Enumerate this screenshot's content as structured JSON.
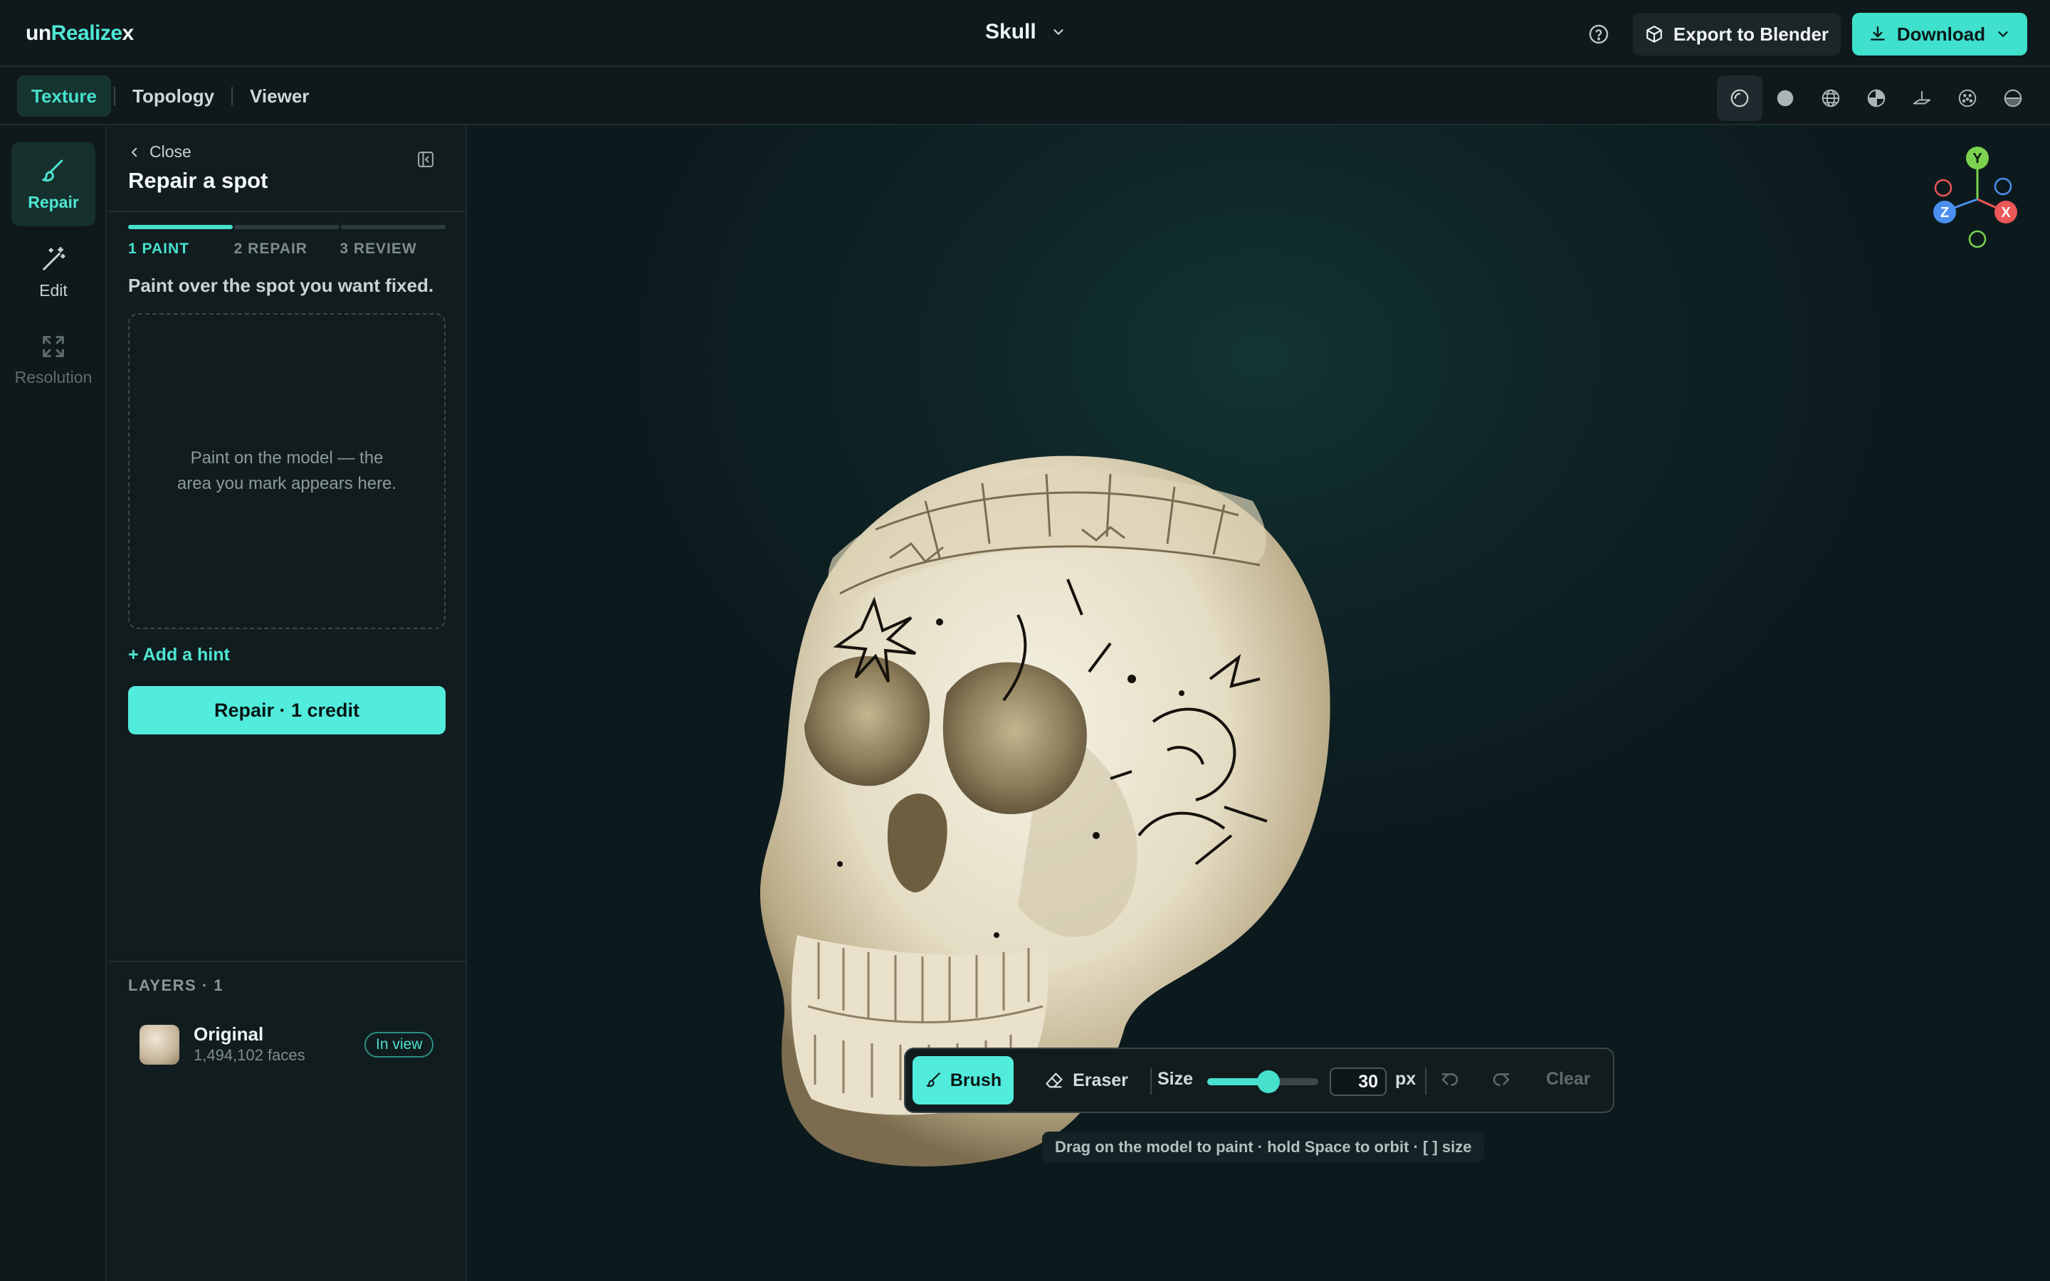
{
  "app": {
    "logo_prefix": "un",
    "logo_accent": "Realize",
    "logo_suffix": "x",
    "brand_color": "#46e0cd"
  },
  "header": {
    "title": "Skull",
    "export_label": "Export to Blender",
    "download_label": "Download"
  },
  "mode_tabs": [
    {
      "label": "Texture",
      "active": true
    },
    {
      "label": "Topology",
      "active": false
    },
    {
      "label": "Viewer",
      "active": false
    }
  ],
  "view_modes": [
    "shaded-icon",
    "solid-icon",
    "wireframe-icon",
    "uv-checker-icon",
    "plane-icon",
    "texture-dots-icon",
    "half-sphere-icon"
  ],
  "rail": [
    {
      "label": "Repair",
      "icon": "brush-icon",
      "state": "active"
    },
    {
      "label": "Edit",
      "icon": "magic-wand-icon",
      "state": "normal"
    },
    {
      "label": "Resolution",
      "icon": "expand-icon",
      "state": "disabled"
    }
  ],
  "panel": {
    "close_label": "Close",
    "title": "Repair a spot",
    "steps": [
      {
        "label": "1 PAINT",
        "active": true
      },
      {
        "label": "2 REPAIR",
        "active": false
      },
      {
        "label": "3 REVIEW",
        "active": false
      }
    ],
    "instruction": "Paint over the spot you want fixed.",
    "paint_placeholder": "Paint on the model — the area you mark appears here.",
    "add_hint_label": "+ Add a hint",
    "repair_button_label": "Repair · 1 credit"
  },
  "layers": {
    "title": "LAYERS · 1",
    "items": [
      {
        "name": "Original",
        "meta": "1,494,102 faces",
        "badge": "In view"
      }
    ]
  },
  "gizmo": {
    "y": "Y",
    "x": "X",
    "z": "Z"
  },
  "toolbar": {
    "brush_label": "Brush",
    "eraser_label": "Eraser",
    "size_label": "Size",
    "size_value": "30",
    "size_fraction": 0.55,
    "unit": "px",
    "clear_label": "Clear"
  },
  "hint_text": "Drag on the model to paint · hold Space to orbit · [ ] size"
}
